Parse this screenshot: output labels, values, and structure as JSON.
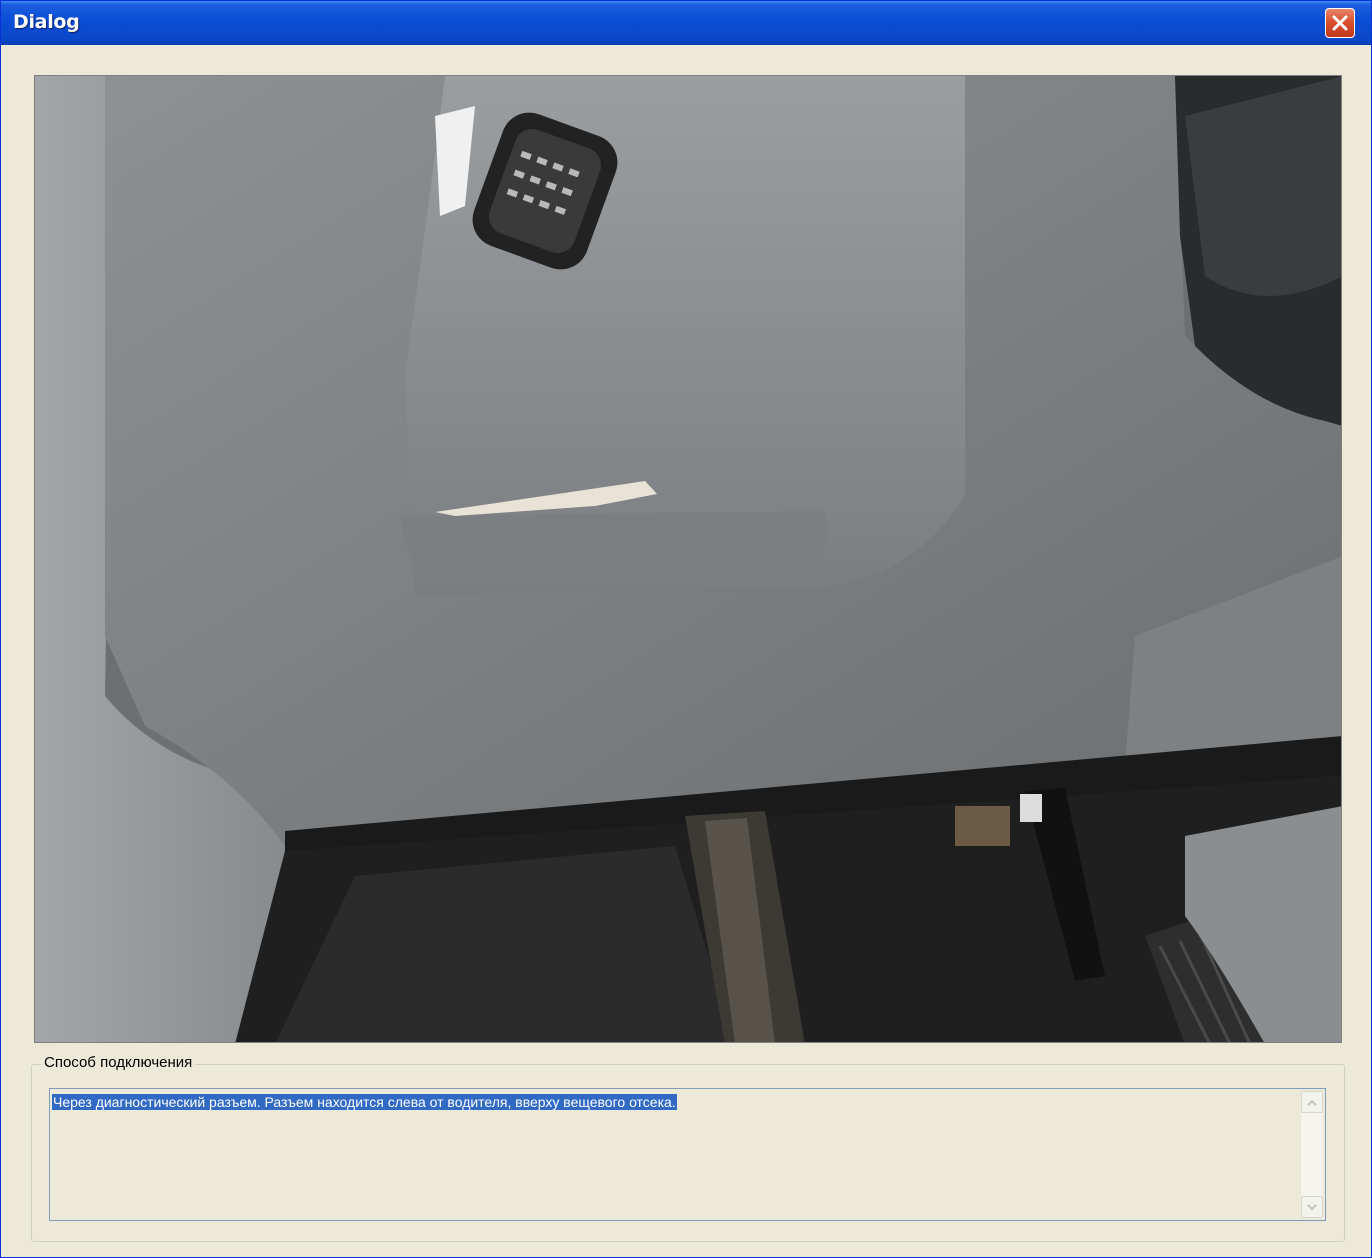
{
  "window": {
    "title": "Dialog",
    "close_icon": "close-icon"
  },
  "photo": {
    "icon": "car-footwell-photo"
  },
  "connection": {
    "group_label": "Способ подключения",
    "text": "Через диагностический разъем. Разъем находится слева от водителя, вверху вещевого отсека."
  },
  "colors": {
    "titlebar": "#0a4fd8",
    "window_bg": "#ece9d8",
    "selection": "#316ac5",
    "close_button": "#d9502e"
  }
}
